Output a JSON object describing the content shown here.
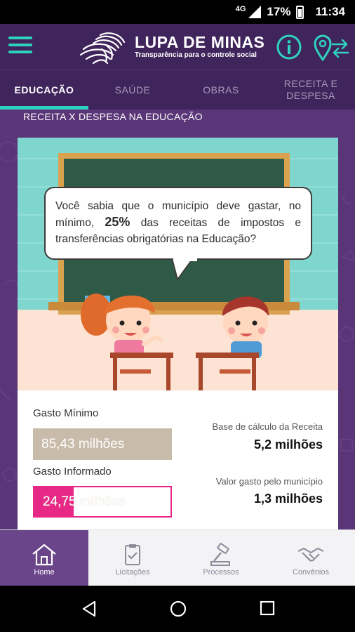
{
  "status_bar": {
    "network": "4G",
    "battery": "17%",
    "time": "11:34"
  },
  "app": {
    "title": "LUPA DE MINAS",
    "subtitle": "Transparência para o controle social",
    "icons": {
      "menu": "menu-icon",
      "info": "info-icon",
      "location": "location-swap-icon",
      "logo": "fingerprint-logo"
    },
    "accent": "#2ed3bf",
    "header_color": "#40245c"
  },
  "tabs": [
    {
      "label": "EDUCAÇÃO",
      "active": true
    },
    {
      "label": "SAÚDE",
      "active": false
    },
    {
      "label": "OBRAS",
      "active": false
    },
    {
      "label": "RECEITA E DESPESA",
      "active": false
    }
  ],
  "section_title": "RECEITA X DESPESA NA EDUCAÇÃO",
  "info_bubble": {
    "prefix": "Você sabia que o município deve gastar, no mínimo,",
    "highlight": "25%",
    "suffix": "das receitas de impostos e transferências obrigatórias na Educação?"
  },
  "stats": {
    "minimum_label": "Gasto Mínimo",
    "minimum_value": "85,43 milhões",
    "informed_label": "Gasto Informado",
    "informed_value": "24,75 milhões",
    "informed_fill_fraction": 0.29,
    "base_label": "Base de cálculo da Receita",
    "base_value": "5,2 milhões",
    "spent_label": "Valor gasto pelo município",
    "spent_value": "1,3 milhões",
    "colors": {
      "minimum": "#c9bba9",
      "informed": "#e82886"
    }
  },
  "bottom_nav": [
    {
      "label": "Home",
      "icon": "home-icon",
      "active": true
    },
    {
      "label": "Licitações",
      "icon": "clipboard-check-icon",
      "active": false
    },
    {
      "label": "Processos",
      "icon": "gavel-icon",
      "active": false
    },
    {
      "label": "Convênios",
      "icon": "handshake-icon",
      "active": false
    }
  ],
  "system_nav": {
    "back": "back-icon",
    "home": "home-circle-icon",
    "recents": "recents-icon"
  }
}
